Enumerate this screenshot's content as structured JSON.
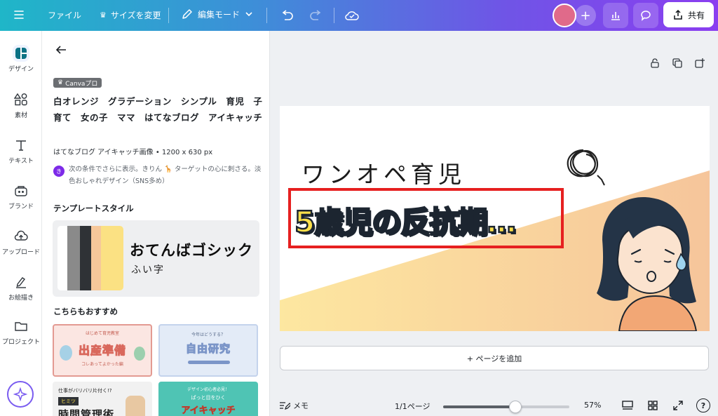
{
  "topbar": {
    "file_label": "ファイル",
    "resize_label": "サイズを変更",
    "edit_mode_label": "編集モード",
    "share_label": "共有"
  },
  "rail": {
    "items": [
      {
        "label": "デザイン",
        "icon": "design-icon"
      },
      {
        "label": "素材",
        "icon": "elements-icon"
      },
      {
        "label": "テキスト",
        "icon": "text-icon"
      },
      {
        "label": "ブランド",
        "icon": "brand-icon"
      },
      {
        "label": "アップロード",
        "icon": "upload-icon"
      },
      {
        "label": "お絵描き",
        "icon": "draw-icon"
      },
      {
        "label": "プロジェクト",
        "icon": "folder-icon"
      }
    ]
  },
  "panel": {
    "pro_badge": "Canvaプロ",
    "template_title": "白オレンジ　グラデーション　シンプル　育児　子育て　女の子　ママ　はてなブログ　アイキャッチ",
    "template_meta": "はてなブログ アイキャッチ画像 • 1200 x 630 px",
    "ai_badge": "き",
    "ai_text": "次の条件でさらに表示。きりん 🦒 ターゲットの心に刺さる。淡色おしゃれデザイン（SNS多め）",
    "style_heading": "テンプレートスタイル",
    "style_font_display": "おてんばゴシック",
    "style_font_sub": "ふい字",
    "style_colors": [
      "#ffffff",
      "#8a8a8a",
      "#2f3236",
      "#f6c79a",
      "#fbe183"
    ],
    "recommend_heading": "こちらもおすすめ",
    "recommendations": [
      {
        "small": "はじめて育児教室",
        "title": "出産準備",
        "sub": "コレあってよかった編"
      },
      {
        "small": "今年はどうする？",
        "title": "自由研究",
        "sub": ""
      },
      {
        "small": "仕事がバリバリ片付く!?",
        "tag": "ヒミツ",
        "title": "時間管理術",
        "sub": ""
      },
      {
        "small": "デザイン初心者必見！",
        "title": "アイキャッチ",
        "sub": "ぱっと目をひく"
      }
    ]
  },
  "canvas": {
    "subtitle": "ワンオペ育児",
    "headline": "5歳児の反抗期…",
    "add_page_label": "+ ページを追加"
  },
  "bottombar": {
    "notes_label": "メモ",
    "page_indicator": "1/1ページ",
    "zoom_label": "57%",
    "zoom_fraction": 0.57,
    "help_label": "?"
  },
  "colors": {
    "accent": "#7d2ae8",
    "topbar_start": "#1fb6c8",
    "topbar_end": "#8a3ef0",
    "highlight_box": "#e62020",
    "headline_fill": "#fce04a"
  }
}
